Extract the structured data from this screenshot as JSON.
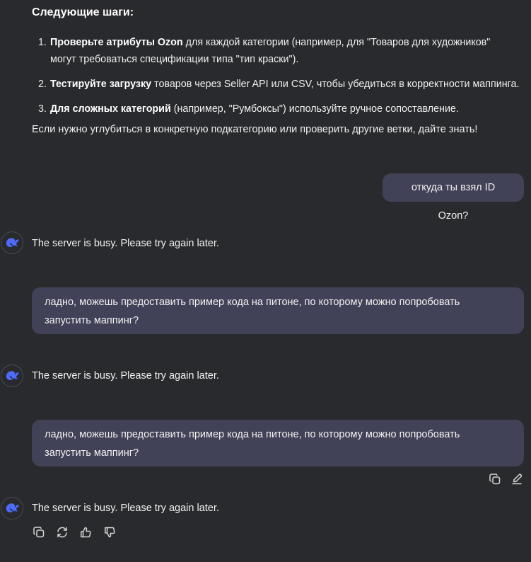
{
  "next_steps": {
    "heading": "Следующие шаги:",
    "items": [
      {
        "num": "1.",
        "bold": "Проверьте атрибуты Ozon",
        "line1": " для каждой категории (например, для \"Товаров для художников\"",
        "line2": "могут требоваться спецификации типа \"тип краски\")."
      },
      {
        "num": "2.",
        "bold": "Тестируйте загрузку",
        "line1": " товаров через Seller API или CSV, чтобы убедиться в корректности маппинга."
      },
      {
        "num": "3.",
        "bold": "Для сложных категорий",
        "line1": " (например, \"Румбоксы\") используйте ручное сопоставление."
      }
    ],
    "closing": "Если нужно углубиться в конкретную подкатегорию или проверить другие ветки, дайте знать!"
  },
  "messages": {
    "user_1": "откуда ты взял ID Ozon?",
    "bot_1": "The server is busy. Please try again later.",
    "user_2": {
      "line1": "ладно, можешь предоставить пример кода на питоне, по которому можно попробовать",
      "line2": "запустить маппинг?"
    },
    "bot_2": "The server is busy. Please try again later.",
    "user_3": {
      "line1": "ладно, можешь предоставить пример кода на питоне, по которому можно попробовать",
      "line2": "запустить маппинг?"
    },
    "bot_3": "The server is busy. Please try again later."
  },
  "icons": {
    "avatar": "deepseek-whale-icon",
    "user_actions": [
      "copy-icon",
      "edit-icon"
    ],
    "bot_actions": [
      "copy-icon",
      "regenerate-icon",
      "thumbs-up-icon",
      "thumbs-down-icon"
    ]
  },
  "colors": {
    "background": "#292a2d",
    "user_bubble": "#414158",
    "brand": "#4d6bfe"
  }
}
